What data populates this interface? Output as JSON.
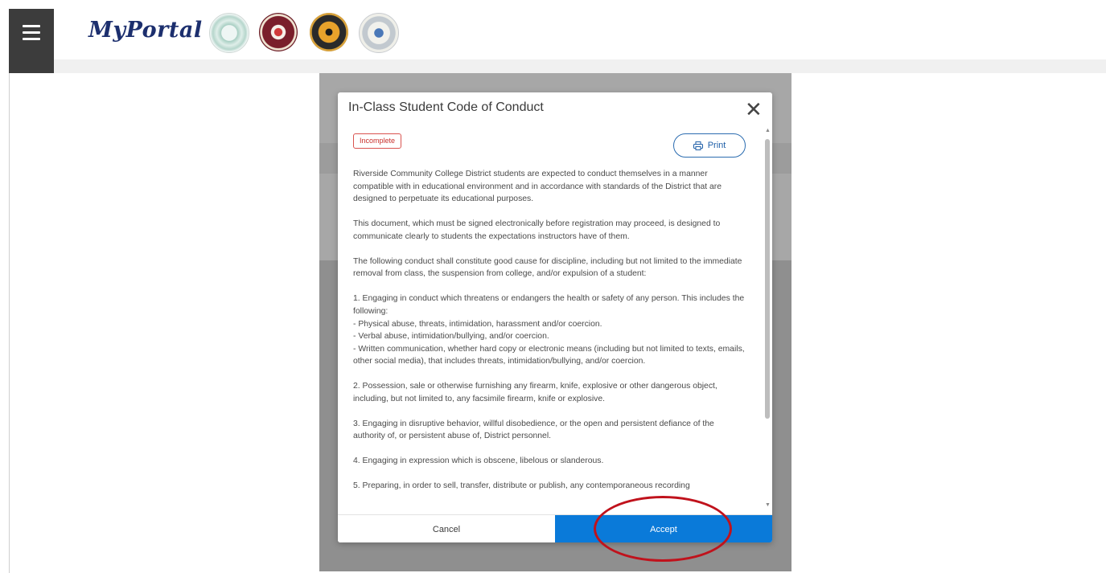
{
  "header": {
    "brand": "MyPortal",
    "seals": [
      "college-seal-1",
      "college-seal-2",
      "college-seal-3",
      "college-seal-4"
    ]
  },
  "modal": {
    "title": "In-Class Student Code of Conduct",
    "close_glyph": "✕",
    "status_badge": "Incomplete",
    "print_label": "Print",
    "paragraphs": [
      "Riverside Community College District students are expected to conduct themselves in a manner compatible with in educational environment and in accordance with standards of the District that are designed to perpetuate its educational purposes.",
      " This document, which must be signed electronically before registration may proceed, is designed to communicate clearly to students the expectations instructors have of them.",
      " The following conduct shall constitute good cause for discipline, including but not limited to the immediate removal from class, the suspension from college, and/or expulsion of a student:",
      " 1. Engaging in conduct which threatens or endangers the health or safety of any person. This includes the following:\n  - Physical abuse, threats, intimidation, harassment and/or coercion.\n  - Verbal abuse, intimidation/bullying, and/or coercion.\n  - Written communication, whether hard copy or electronic means (including but not limited to texts, emails, other social media), that includes threats, intimidation/bullying, and/or coercion.",
      " 2. Possession, sale or otherwise furnishing any firearm, knife, explosive or other dangerous object, including, but not limited to, any facsimile firearm, knife or explosive.",
      " 3. Engaging in disruptive behavior, willful disobedience, or the open and persistent defiance of the authority of, or persistent abuse of, District personnel.",
      " 4. Engaging in expression which is obscene, libelous or slanderous.",
      " 5. Preparing, in order to sell, transfer, distribute or publish, any contemporaneous recording"
    ],
    "cancel_label": "Cancel",
    "accept_label": "Accept"
  },
  "colors": {
    "accent": "#0a7ad9",
    "brand": "#1c2f6e",
    "badge": "#c9302c",
    "annotation": "#c0121c"
  }
}
